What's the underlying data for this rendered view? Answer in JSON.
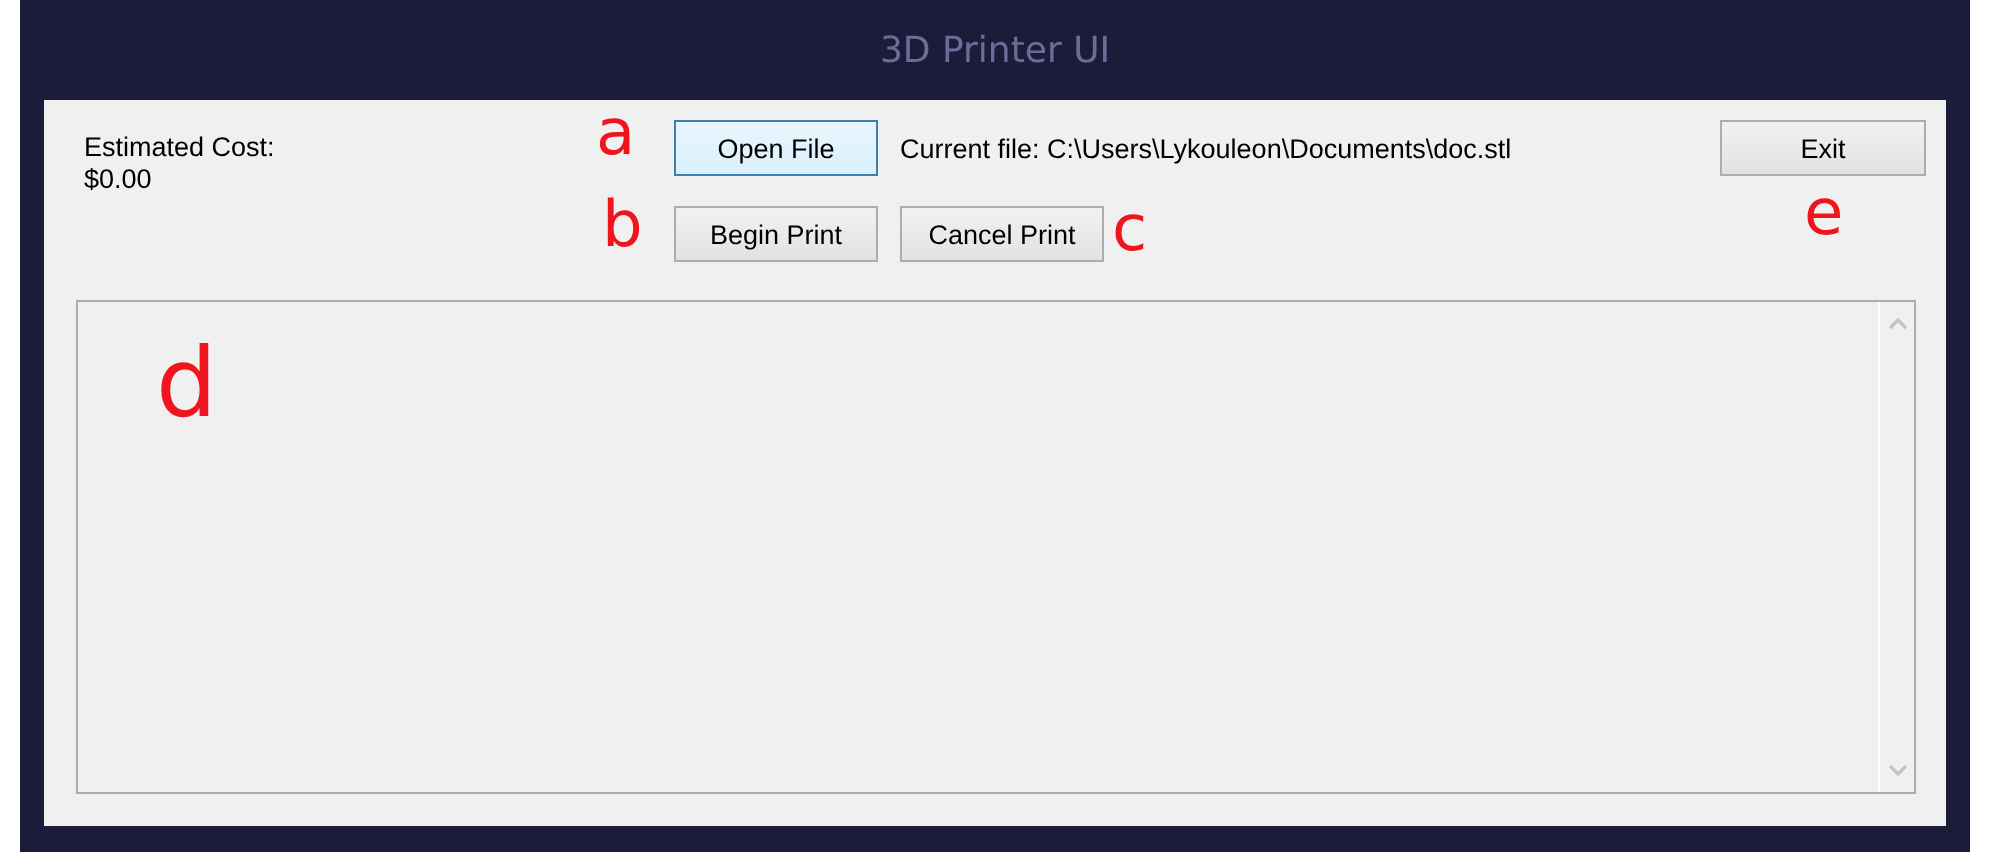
{
  "window": {
    "title": "3D Printer UI"
  },
  "estimated_cost": {
    "label": "Estimated Cost:",
    "value": "$0.00"
  },
  "buttons": [
    {
      "label": "Open File",
      "focused": true
    },
    {
      "label": "Begin Print",
      "focused": false
    },
    {
      "label": "Cancel Print",
      "focused": false
    },
    {
      "label": "Exit",
      "focused": false
    }
  ],
  "current_file": "Current file: C:\\Users\\Lykouleon\\Documents\\doc.stl",
  "annotations": [
    "a",
    "b",
    "c",
    "d",
    "e"
  ]
}
